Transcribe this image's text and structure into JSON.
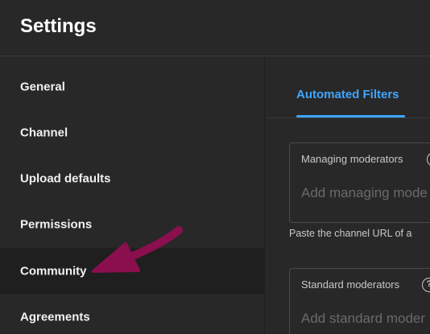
{
  "header": {
    "title": "Settings"
  },
  "sidebar": {
    "items": [
      {
        "label": "General"
      },
      {
        "label": "Channel"
      },
      {
        "label": "Upload defaults"
      },
      {
        "label": "Permissions"
      },
      {
        "label": "Community",
        "active": true
      },
      {
        "label": "Agreements"
      }
    ]
  },
  "main": {
    "tabs": [
      {
        "label": "Automated Filters",
        "active": true
      }
    ],
    "managing": {
      "label": "Managing moderators",
      "placeholder": "Add managing mode",
      "hint": "Paste the channel URL of a"
    },
    "standard": {
      "label": "Standard moderators",
      "placeholder": "Add standard moder"
    }
  },
  "colors": {
    "accent": "#3ea6ff",
    "annotation_arrow": "#8b0f4f"
  },
  "icons": {
    "help": "question-circle-icon"
  }
}
